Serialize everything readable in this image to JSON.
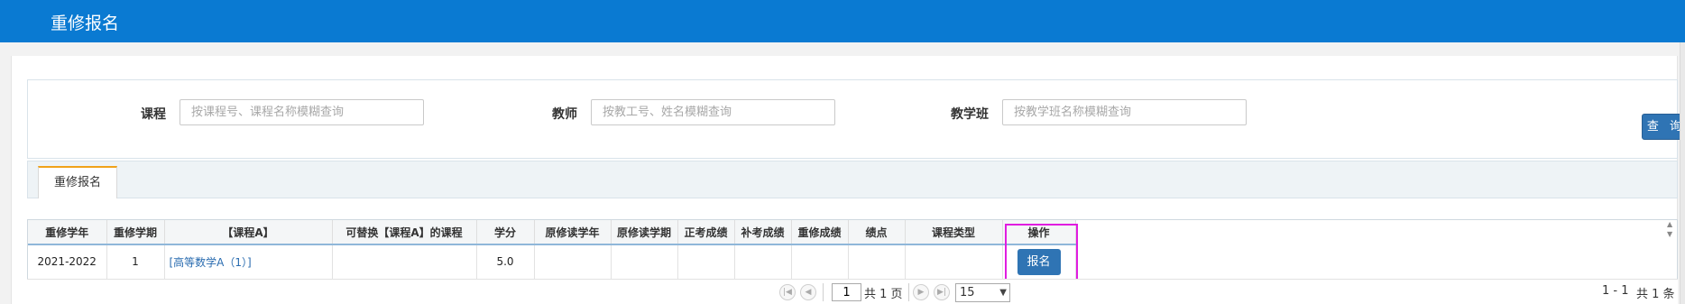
{
  "header": {
    "title": "重修报名"
  },
  "filters": {
    "course": {
      "label": "课程",
      "placeholder": "按课程号、课程名称模糊查询",
      "value": ""
    },
    "teacher": {
      "label": "教师",
      "placeholder": "按教工号、姓名模糊查询",
      "value": ""
    },
    "class": {
      "label": "教学班",
      "placeholder": "按教学班名称模糊查询",
      "value": ""
    },
    "query_label": "查 询"
  },
  "tabs": [
    {
      "label": "重修报名",
      "active": true
    }
  ],
  "table": {
    "columns": [
      "重修学年",
      "重修学期",
      "【课程A】",
      "可替换【课程A】的课程",
      "学分",
      "原修读学年",
      "原修读学期",
      "正考成绩",
      "补考成绩",
      "重修成绩",
      "绩点",
      "课程类型",
      "操作"
    ],
    "rows": [
      {
        "year": "2021-2022",
        "term": "1",
        "course": "[高等数学A（1）]",
        "replace_course": "",
        "credit": "5.0",
        "orig_year": "",
        "orig_term": "",
        "regular_score": "",
        "makeup_score": "",
        "retake_score": "",
        "gpa": "",
        "course_type": "",
        "action": "报名"
      }
    ]
  },
  "pager": {
    "current_page": "1",
    "total_pages_text": "共 1 页",
    "page_size": "15",
    "range_text": "1 - 1",
    "total_text": "共 1 条"
  },
  "colors": {
    "header_bg": "#0a7ad2",
    "button_bg": "#2f74b4",
    "tab_accent": "#f0a21a",
    "highlight": "#e01ce0"
  }
}
